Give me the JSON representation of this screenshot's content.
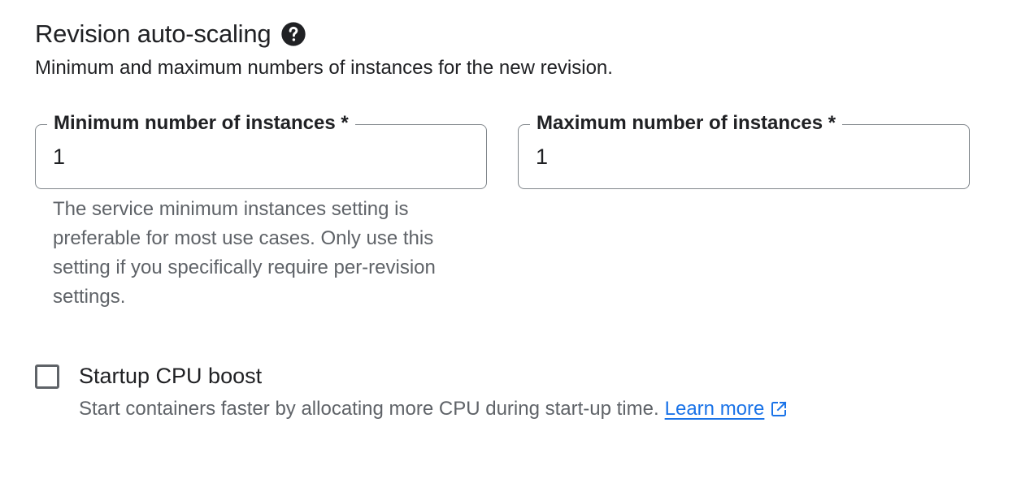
{
  "section": {
    "title": "Revision auto-scaling",
    "help_icon": "help-circle-icon",
    "description": "Minimum and maximum numbers of instances for the new revision."
  },
  "min_instances": {
    "label": "Minimum number of instances *",
    "value": "1",
    "helper": "The service minimum instances setting is preferable for most use cases. Only use this setting if you specifically require per-revision settings."
  },
  "max_instances": {
    "label": "Maximum number of instances *",
    "value": "1"
  },
  "cpu_boost": {
    "label": "Startup CPU boost",
    "checked": false,
    "description": "Start containers faster by allocating more CPU during start-up time.",
    "link_text": "Learn more",
    "link_icon": "open-in-new-icon"
  },
  "colors": {
    "text_primary": "#202124",
    "text_secondary": "#5f6368",
    "border": "#80868b",
    "link": "#1a73e8"
  }
}
